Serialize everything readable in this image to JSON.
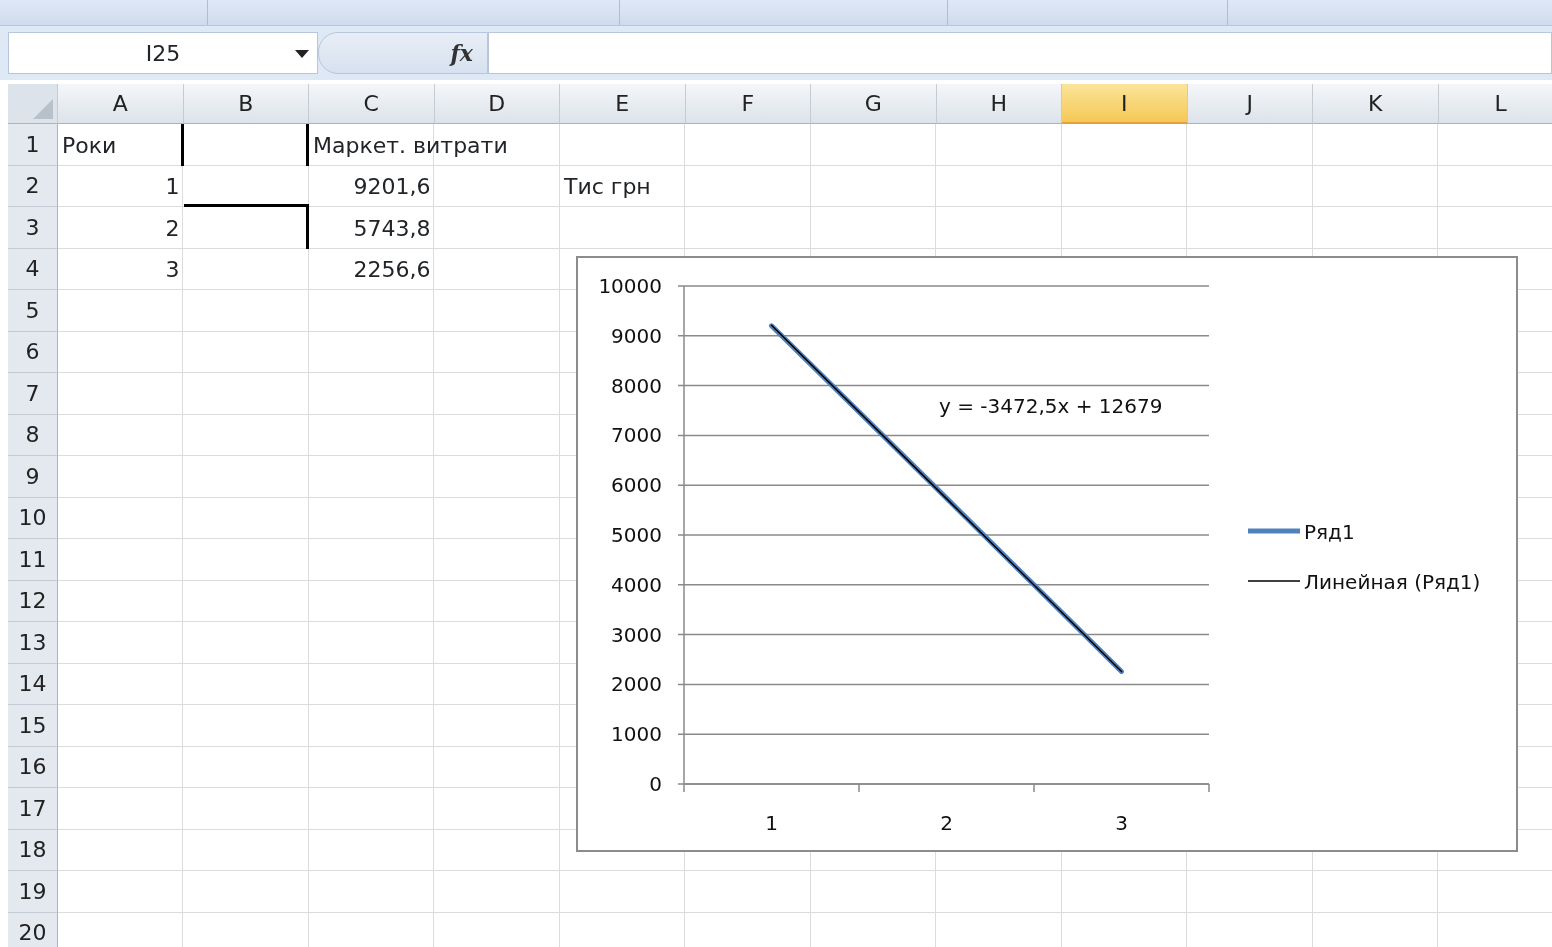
{
  "formula_bar": {
    "name_box": "I25",
    "function_label": "fx"
  },
  "columns": [
    {
      "label": "A",
      "selected": false
    },
    {
      "label": "B",
      "selected": false
    },
    {
      "label": "C",
      "selected": false
    },
    {
      "label": "D",
      "selected": false
    },
    {
      "label": "E",
      "selected": false
    },
    {
      "label": "F",
      "selected": false
    },
    {
      "label": "G",
      "selected": false
    },
    {
      "label": "H",
      "selected": false
    },
    {
      "label": "I",
      "selected": true
    },
    {
      "label": "J",
      "selected": false
    },
    {
      "label": "K",
      "selected": false
    },
    {
      "label": "L",
      "selected": false
    }
  ],
  "rows": [
    {
      "label": "1",
      "cells": {
        "A": {
          "text": "Роки",
          "kind": "text",
          "thick_right": true
        },
        "B": {
          "thick_right": true
        },
        "C": {
          "text": "Маркет. витрати",
          "kind": "text"
        }
      }
    },
    {
      "label": "2",
      "cells": {
        "A": {
          "text": "1",
          "kind": "number"
        },
        "B": {
          "thick_bottom": true
        },
        "C": {
          "text": "9201,6",
          "kind": "number"
        },
        "E": {
          "text": "Тис грн",
          "kind": "text"
        }
      }
    },
    {
      "label": "3",
      "cells": {
        "A": {
          "text": "2",
          "kind": "number"
        },
        "B": {
          "thick_right": true
        },
        "C": {
          "text": "5743,8",
          "kind": "number"
        }
      }
    },
    {
      "label": "4",
      "cells": {
        "A": {
          "text": "3",
          "kind": "number"
        },
        "C": {
          "text": "2256,6",
          "kind": "number"
        }
      }
    },
    {
      "label": "5"
    },
    {
      "label": "6"
    },
    {
      "label": "7"
    },
    {
      "label": "8"
    },
    {
      "label": "9"
    },
    {
      "label": "10"
    },
    {
      "label": "11"
    },
    {
      "label": "12"
    },
    {
      "label": "13"
    },
    {
      "label": "14"
    },
    {
      "label": "15"
    },
    {
      "label": "16"
    },
    {
      "label": "17"
    },
    {
      "label": "18"
    },
    {
      "label": "19"
    },
    {
      "label": "20"
    }
  ],
  "chart": {
    "chart_data": {
      "type": "line",
      "categories": [
        "1",
        "2",
        "3"
      ],
      "series": [
        {
          "name": "Ряд1",
          "color": "#4f81bd",
          "values": [
            9200,
            5740,
            2260
          ]
        },
        {
          "name": "Линейная (Ряд1)",
          "color": "#000000",
          "values": [
            9210,
            5730,
            2260
          ]
        }
      ],
      "grid": true,
      "legend": true,
      "ylim": [
        0,
        10000
      ],
      "yticks": [
        0,
        1000,
        2000,
        3000,
        4000,
        5000,
        6000,
        7000,
        8000,
        9000,
        10000
      ],
      "annotations": [
        {
          "text": "y = -3472,5x + 12679"
        }
      ]
    }
  }
}
